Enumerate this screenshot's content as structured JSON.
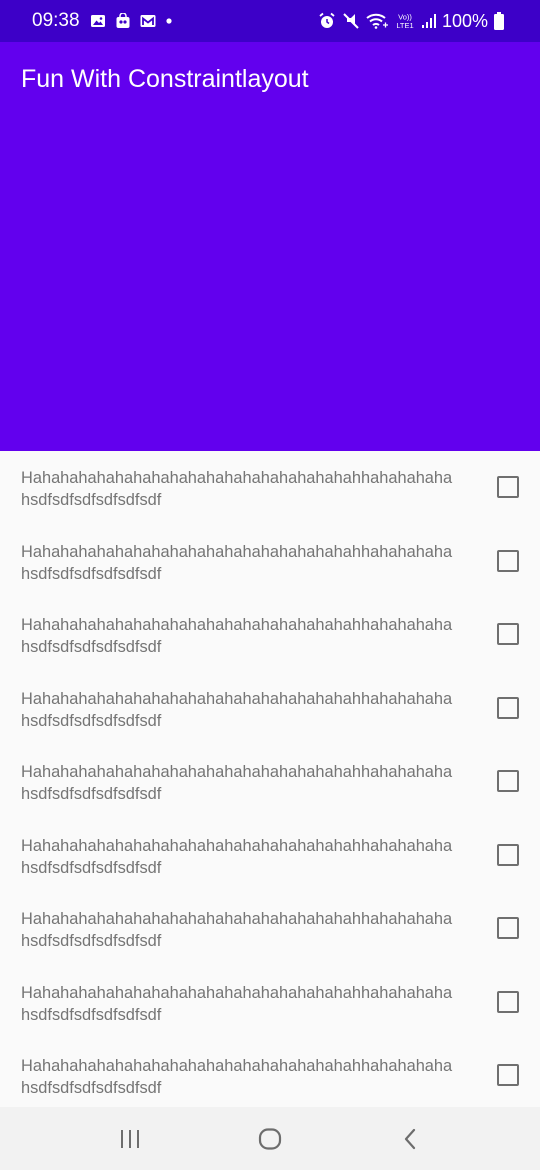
{
  "status_bar": {
    "time": "09:38",
    "notification_icons": [
      "gallery-icon",
      "shopping-bag-icon",
      "gmail-icon",
      "dot-icon"
    ],
    "system_icons": [
      "alarm-icon",
      "mute-icon",
      "wifi-icon",
      "volte-icon",
      "signal-icon",
      "battery-icon"
    ],
    "volte_label": "Vo)) LTE1",
    "battery": "100%"
  },
  "app_bar": {
    "title": "Fun With Constraintlayout",
    "color": "#6200ee"
  },
  "list": {
    "items": [
      {
        "line1": "Hahahahahahahahahahahahahahahahahahahhahahahaha",
        "line2": "hsdfsdfsdfsdfsdfsdf",
        "checked": false
      },
      {
        "line1": "Hahahahahahahahahahahahahahahahahahahhahahahaha",
        "line2": "hsdfsdfsdfsdfsdfsdf",
        "checked": false
      },
      {
        "line1": "Hahahahahahahahahahahahahahahahahahahhahahahaha",
        "line2": "hsdfsdfsdfsdfsdfsdf",
        "checked": false
      },
      {
        "line1": "Hahahahahahahahahahahahahahahahahahahhahahahaha",
        "line2": "hsdfsdfsdfsdfsdfsdf",
        "checked": false
      },
      {
        "line1": "Hahahahahahahahahahahahahahahahahahahhahahahaha",
        "line2": "hsdfsdfsdfsdfsdfsdf",
        "checked": false
      },
      {
        "line1": "Hahahahahahahahahahahahahahahahahahahhahahahaha",
        "line2": "hsdfsdfsdfsdfsdfsdf",
        "checked": false
      },
      {
        "line1": "Hahahahahahahahahahahahahahahahahahahhahahahaha",
        "line2": "hsdfsdfsdfsdfsdfsdf",
        "checked": false
      },
      {
        "line1": "Hahahahahahahahahahahahahahahahahahahhahahahaha",
        "line2": "hsdfsdfsdfsdfsdfsdf",
        "checked": false
      },
      {
        "line1": "Hahahahahahahahahahahahahahahahahahahhahahahaha",
        "line2": "hsdfsdfsdfsdfsdfsdf",
        "checked": false
      }
    ]
  },
  "nav_bar": {
    "buttons": [
      "recent-apps-icon",
      "home-icon",
      "back-icon"
    ]
  }
}
